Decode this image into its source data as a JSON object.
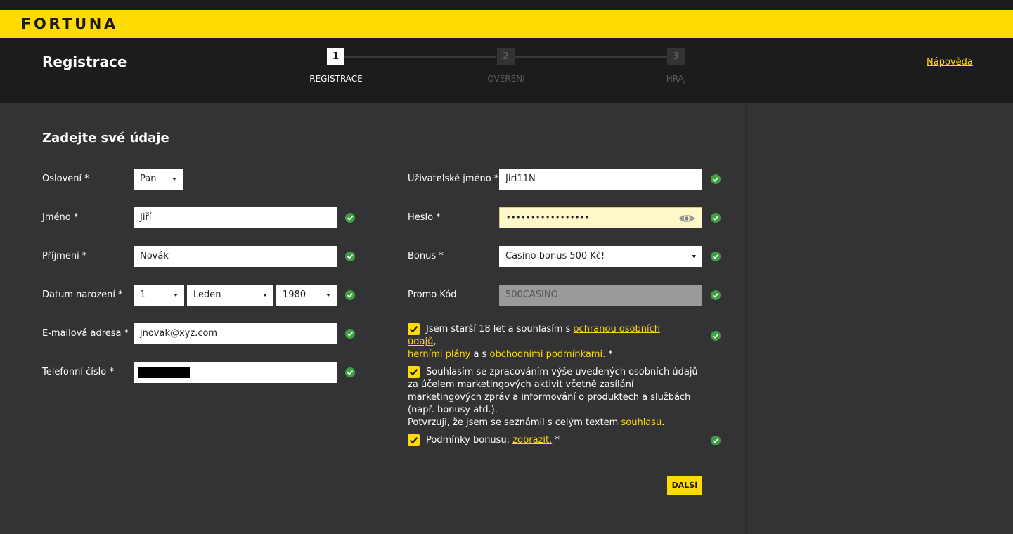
{
  "brand": {
    "logo_text": "FORTUNA",
    "accent": "#ffdb01"
  },
  "header": {
    "title": "Registrace",
    "help_link": "Nápověda",
    "steps": [
      {
        "number": "1",
        "label": "REGISTRACE",
        "state": "active"
      },
      {
        "number": "2",
        "label": "OVĚŘENÍ",
        "state": "inactive"
      },
      {
        "number": "3",
        "label": "HRAJ",
        "state": "inactive"
      }
    ]
  },
  "form": {
    "section_title": "Zadejte své údaje",
    "salutation": {
      "label": "Oslovení *",
      "value": "Pan"
    },
    "first_name": {
      "label": "Jméno *",
      "value": "Jiří"
    },
    "last_name": {
      "label": "Příjmení *",
      "value": "Novák"
    },
    "birth_date": {
      "label": "Datum narození *",
      "day": "1",
      "month": "Leden",
      "year": "1980"
    },
    "email": {
      "label": "E-mailová adresa *",
      "value": "jnovak@xyz.com"
    },
    "phone": {
      "label": "Telefonní číslo *"
    },
    "username": {
      "label": "Uživatelské jméno *",
      "value": "Jiri11N"
    },
    "password": {
      "label": "Heslo *",
      "value": "•••••••••••••••••"
    },
    "bonus": {
      "label": "Bonus *",
      "value": "Casino bonus 500 Kč!"
    },
    "promo_code": {
      "label": "Promo Kód",
      "value": "500CASINO"
    },
    "consent_age": {
      "text_1": "Jsem starší 18 let a souhlasím s ",
      "link_1": "ochranou osobních údajů",
      "text_2": ",",
      "link_2": "herními plány",
      "text_3": " a s ",
      "link_3": "obchodními podmínkami.",
      "text_4": " *"
    },
    "consent_marketing": {
      "text_1": "Souhlasím se zpracováním výše uvedených osobních údajů za účelem marketingových aktivit včetně zasílání marketingových zpráv a informování o produktech a službách (např. bonusy atd.).",
      "text_2": "Potvrzuji, že jsem se seznámil s celým textem ",
      "link": "souhlasu",
      "text_3": "."
    },
    "consent_bonus": {
      "text_1": "Podmínky bonusu: ",
      "link": "zobrazit.",
      "text_2": " *"
    },
    "next_button": "DALŠÍ"
  }
}
